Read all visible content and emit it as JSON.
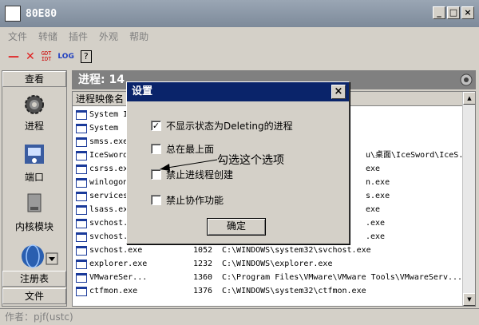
{
  "window": {
    "title": "80E80"
  },
  "titlebar_buttons": {
    "min": "_",
    "max": "□",
    "close": "×"
  },
  "menu": [
    "文件",
    "转储",
    "插件",
    "外观",
    "帮助"
  ],
  "toolbar": {
    "minus": "—",
    "kill": "✕",
    "log": "LOG",
    "help": "?",
    "small1": "GDT",
    "small2": "IDT"
  },
  "sidebar": {
    "header": "查看",
    "items": [
      {
        "label": "进程",
        "icon": "gear-icon"
      },
      {
        "label": "端口",
        "icon": "network-port-icon"
      },
      {
        "label": "内核模块",
        "icon": "kernel-module-icon"
      }
    ],
    "bottom_items": [
      "注册表",
      "文件"
    ]
  },
  "process_header": "进程: 14",
  "process_list": {
    "column": "进程映像名",
    "rows": [
      {
        "name": "System I",
        "pid": "",
        "path": ""
      },
      {
        "name": "System",
        "pid": "",
        "path": ""
      },
      {
        "name": "smss.exe",
        "pid": "",
        "path": ""
      },
      {
        "name": "IceSword",
        "pid": "",
        "path": "u\\桌面\\IceSword\\IceS..."
      },
      {
        "name": "csrss.ex",
        "pid": "",
        "path": "exe"
      },
      {
        "name": "winlogon",
        "pid": "",
        "path": "n.exe"
      },
      {
        "name": "services",
        "pid": "",
        "path": "s.exe"
      },
      {
        "name": "lsass.ex",
        "pid": "",
        "path": "exe"
      },
      {
        "name": "svchost.",
        "pid": "",
        "path": ".exe"
      },
      {
        "name": "svchost.",
        "pid": "",
        "path": ".exe"
      },
      {
        "name": "svchost.exe",
        "pid": "1052",
        "path": "C:\\WINDOWS\\system32\\svchost.exe"
      },
      {
        "name": "explorer.exe",
        "pid": "1232",
        "path": "C:\\WINDOWS\\explorer.exe"
      },
      {
        "name": "VMwareSer...",
        "pid": "1360",
        "path": "C:\\Program Files\\VMware\\VMware Tools\\VMwareServ..."
      },
      {
        "name": "ctfmon.exe",
        "pid": "1376",
        "path": "C:\\WINDOWS\\system32\\ctfmon.exe"
      }
    ]
  },
  "status": "作者：pjf(ustc)",
  "dialog": {
    "title": "设置",
    "close": "×",
    "options": [
      {
        "label": "不显示状态为Deleting的进程",
        "checked": true
      },
      {
        "label": "总在最上面",
        "checked": false
      },
      {
        "label": "禁止进线程创建",
        "checked": false
      },
      {
        "label": "禁止协作功能",
        "checked": false
      }
    ],
    "ok": "确定",
    "checkmark": "✓"
  },
  "annotation": "勾选这个选项"
}
